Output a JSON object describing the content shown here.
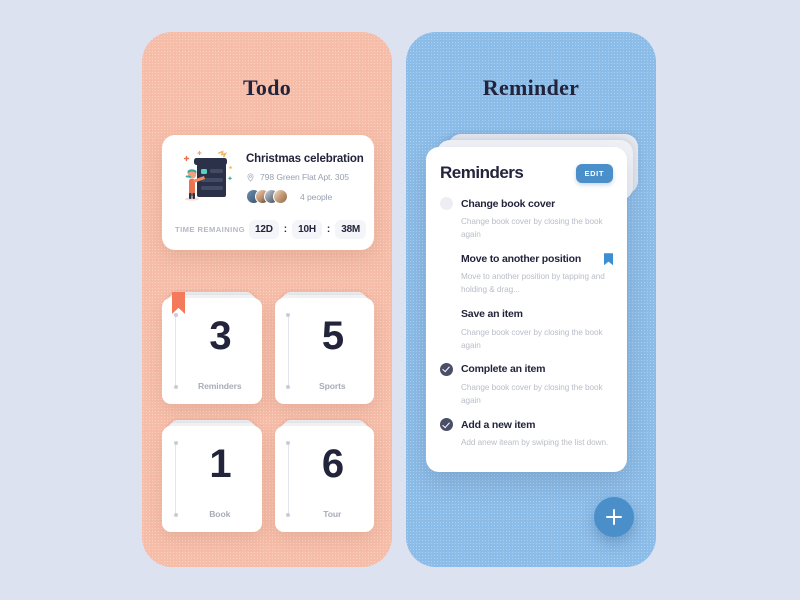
{
  "background_color": "#dde2f0",
  "todo_panel": {
    "title": "Todo",
    "color": "#f6bda8",
    "event_card": {
      "illustration": "person-with-checklist-board-illustration",
      "title": "Christmas celebration",
      "location_icon": "location-pin-icon",
      "location": "798 Green Flat Apt. 305",
      "people": "4 people",
      "time_label": "TIME REMAINING",
      "separator": ":",
      "time_units": [
        {
          "value": "12D"
        },
        {
          "value": "10H"
        },
        {
          "value": "38M"
        }
      ]
    },
    "cards": [
      {
        "number": "3",
        "label": "Reminders",
        "bookmarked": true
      },
      {
        "number": "5",
        "label": "Sports",
        "bookmarked": false
      },
      {
        "number": "1",
        "label": "Book",
        "bookmarked": false
      },
      {
        "number": "6",
        "label": "Tour",
        "bookmarked": false
      }
    ]
  },
  "reminder_panel": {
    "title": "Reminder",
    "color": "#8cbce8",
    "card": {
      "heading": "Reminders",
      "edit_label": "EDIT",
      "accent_color": "#4a8fc9",
      "items": [
        {
          "name": "Change book cover",
          "description": "Change book cover by closing the book again",
          "state": "empty",
          "bookmarked": false
        },
        {
          "name": "Move to another position",
          "description": "Move to another position by tapping and holding & drag...",
          "state": "none",
          "bookmarked": true
        },
        {
          "name": "Save an item",
          "description": "Change book cover by closing the book again",
          "state": "none",
          "bookmarked": false
        },
        {
          "name": "Complete an item",
          "description": "Change book cover by closing the book again",
          "state": "done",
          "bookmarked": false
        },
        {
          "name": "Add a new item",
          "description": "Add anew iteam by swiping the list down.",
          "state": "done",
          "bookmarked": false
        }
      ]
    },
    "fab": {
      "icon": "plus-icon"
    }
  }
}
